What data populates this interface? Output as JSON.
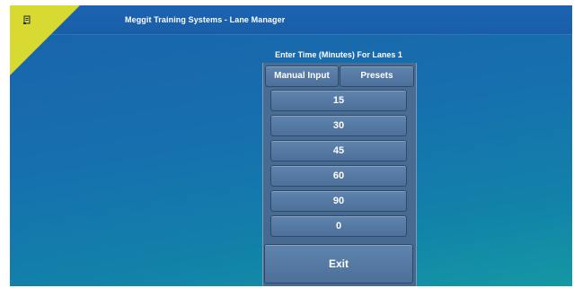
{
  "window": {
    "title": "Meggit Training Systems - Lane Manager",
    "icon": "app-icon",
    "corner_color": "#d8d931"
  },
  "panel": {
    "heading": "Enter Time (Minutes) For Lanes 1",
    "tabs": [
      {
        "label": "Manual Input"
      },
      {
        "label": "Presets"
      }
    ],
    "presets": [
      {
        "label": "15"
      },
      {
        "label": "30"
      },
      {
        "label": "45"
      },
      {
        "label": "60"
      },
      {
        "label": "90"
      },
      {
        "label": "0"
      }
    ],
    "exit_label": "Exit"
  }
}
